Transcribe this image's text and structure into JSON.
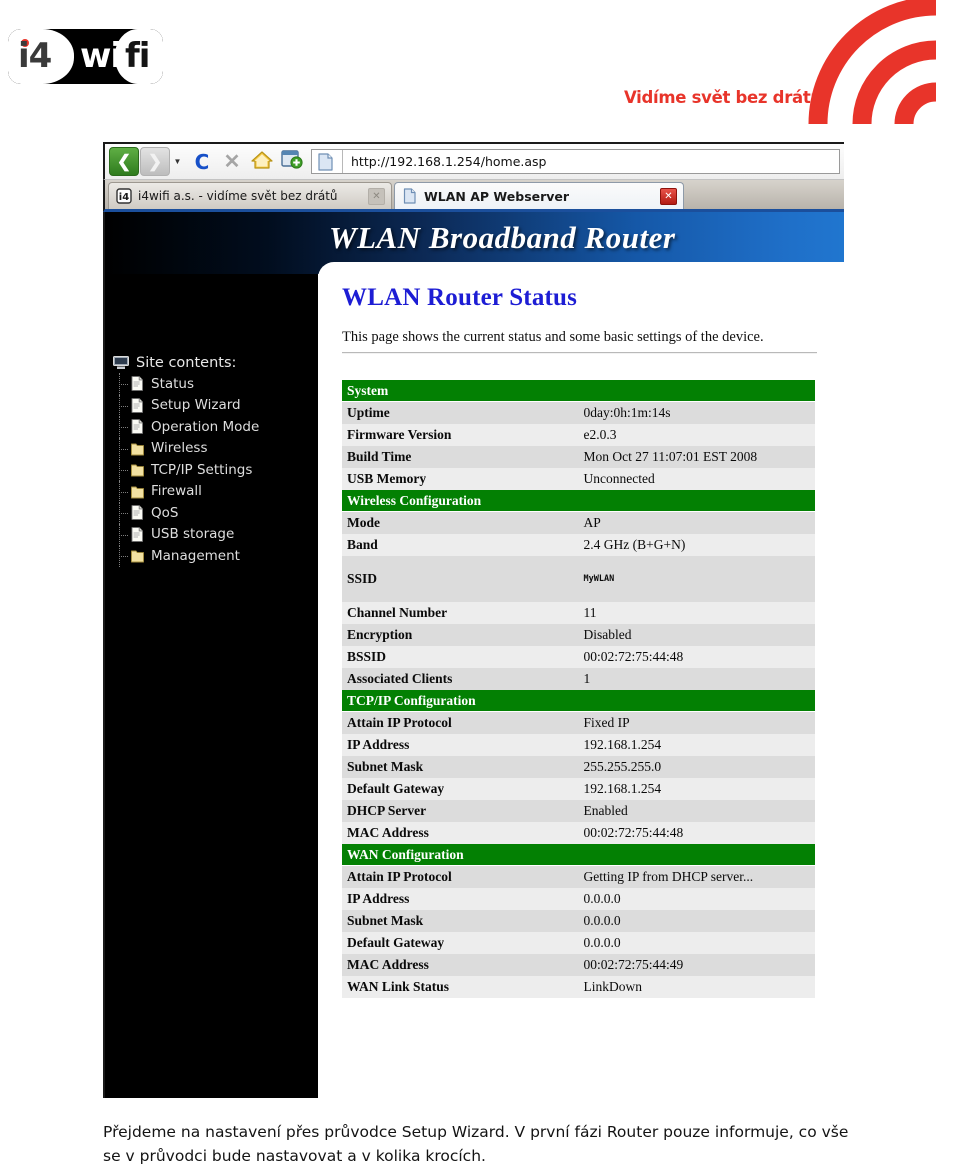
{
  "brand": {
    "logo_part1": "i4",
    "logo_part2": "wi",
    "logo_part3": "fi",
    "tagline": "Vidíme svět bez drátů.",
    "accent_color": "#e8342a"
  },
  "browser": {
    "toolbar": {
      "back_icon": "back-arrow-icon",
      "forward_icon": "forward-arrow-icon",
      "dropdown_icon": "chevron-down-icon",
      "reload_glyph": "C",
      "stop_glyph": "✕",
      "home_icon": "home-icon",
      "bookmark_add_icon": "add-bookmark-icon"
    },
    "url_bar": {
      "value": "http://192.168.1.254/home.asp",
      "favicon": "page-icon"
    },
    "tabs": [
      {
        "label": "i4wifi a.s. - vidíme svět bez drátů",
        "favicon": "i4wifi-favicon",
        "close_glyph": "✕",
        "active": false
      },
      {
        "label": "WLAN AP Webserver",
        "favicon": "page-icon",
        "close_glyph": "✕",
        "active": true
      }
    ]
  },
  "router": {
    "banner_title": "WLAN Broadband Router",
    "sidebar": {
      "root_label": "Site contents:",
      "root_icon": "monitor-icon",
      "items": [
        {
          "label": "Status",
          "icon": "page-icon"
        },
        {
          "label": "Setup Wizard",
          "icon": "page-icon"
        },
        {
          "label": "Operation Mode",
          "icon": "page-icon"
        },
        {
          "label": "Wireless",
          "icon": "folder-icon"
        },
        {
          "label": "TCP/IP Settings",
          "icon": "folder-icon"
        },
        {
          "label": "Firewall",
          "icon": "folder-icon"
        },
        {
          "label": "QoS",
          "icon": "page-icon"
        },
        {
          "label": "USB storage",
          "icon": "page-icon"
        },
        {
          "label": "Management",
          "icon": "folder-icon"
        }
      ]
    },
    "page_title": "WLAN Router Status",
    "page_description": "This page shows the current status and some basic settings of the device.",
    "status_sections": [
      {
        "title": "System",
        "rows": [
          {
            "label": "Uptime",
            "value": "0day:0h:1m:14s"
          },
          {
            "label": "Firmware Version",
            "value": "e2.0.3"
          },
          {
            "label": "Build Time",
            "value": "Mon Oct 27 11:07:01 EST 2008"
          },
          {
            "label": "USB Memory",
            "value": "Unconnected"
          }
        ]
      },
      {
        "title": "Wireless Configuration",
        "rows": [
          {
            "label": "Mode",
            "value": "AP"
          },
          {
            "label": "Band",
            "value": "2.4 GHz (B+G+N)"
          },
          {
            "label": "SSID",
            "value": "MyWLAN",
            "tall": true
          },
          {
            "label": "Channel Number",
            "value": "11"
          },
          {
            "label": "Encryption",
            "value": "Disabled"
          },
          {
            "label": "BSSID",
            "value": "00:02:72:75:44:48"
          },
          {
            "label": "Associated Clients",
            "value": "1"
          }
        ]
      },
      {
        "title": "TCP/IP Configuration",
        "rows": [
          {
            "label": "Attain IP Protocol",
            "value": "Fixed IP"
          },
          {
            "label": "IP Address",
            "value": "192.168.1.254"
          },
          {
            "label": "Subnet Mask",
            "value": "255.255.255.0"
          },
          {
            "label": "Default Gateway",
            "value": "192.168.1.254"
          },
          {
            "label": "DHCP Server",
            "value": "Enabled"
          },
          {
            "label": "MAC Address",
            "value": "00:02:72:75:44:48"
          }
        ]
      },
      {
        "title": "WAN Configuration",
        "rows": [
          {
            "label": "Attain IP Protocol",
            "value": "Getting IP from DHCP server..."
          },
          {
            "label": "IP Address",
            "value": "0.0.0.0"
          },
          {
            "label": "Subnet Mask",
            "value": "0.0.0.0"
          },
          {
            "label": "Default Gateway",
            "value": "0.0.0.0"
          },
          {
            "label": "MAC Address",
            "value": "00:02:72:75:44:49"
          },
          {
            "label": "WAN Link Status",
            "value": "LinkDown"
          }
        ]
      }
    ],
    "section_color": "#038003",
    "title_color": "#1d1dd4"
  },
  "caption": {
    "text": "Přejdeme na nastavení přes průvodce Setup Wizard. V první fázi Router pouze informuje, co vše se v průvodci bude nastavovat a v kolika krocích."
  }
}
